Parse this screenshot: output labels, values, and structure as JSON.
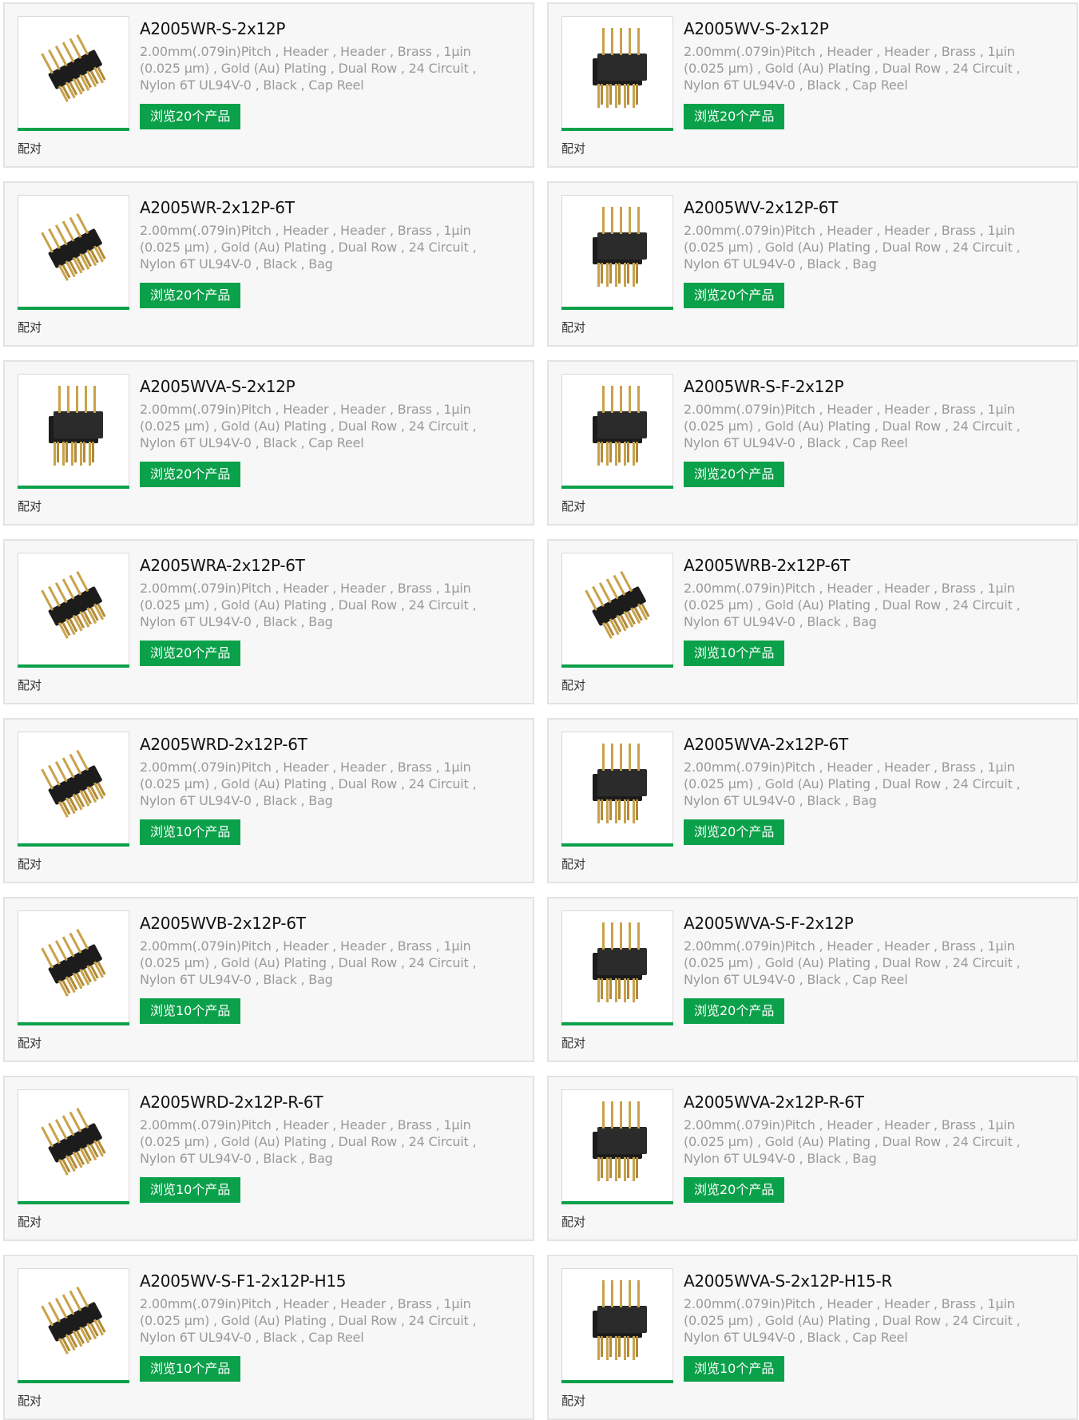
{
  "products": [
    {
      "name": "A2005WR-S-2x12P",
      "desc": "2.00mm(.079in)Pitch , Header , Header , Brass , 1µin (0.025 µm) , Gold (Au) Plating , Dual Row , 24 Circuit , Nylon 6T UL94V-0 , Black , Cap Reel",
      "browse": "浏览20个产品",
      "pair": "配对",
      "image": "right-angle-header-icon"
    },
    {
      "name": "A2005WV-S-2x12P",
      "desc": "2.00mm(.079in)Pitch , Header , Header , Brass , 1µin (0.025 µm) , Gold (Au) Plating , Dual Row , 24 Circuit , Nylon 6T UL94V-0 , Black , Cap Reel",
      "browse": "浏览20个产品",
      "pair": "配对",
      "image": "vertical-header-icon"
    },
    {
      "name": "A2005WR-2x12P-6T",
      "desc": "2.00mm(.079in)Pitch , Header , Header , Brass , 1µin (0.025 µm) , Gold (Au) Plating , Dual Row , 24 Circuit , Nylon 6T UL94V-0 , Black , Bag",
      "browse": "浏览20个产品",
      "pair": "配对",
      "image": "right-angle-header-icon"
    },
    {
      "name": "A2005WV-2x12P-6T",
      "desc": "2.00mm(.079in)Pitch , Header , Header , Brass , 1µin (0.025 µm) , Gold (Au) Plating , Dual Row , 24 Circuit , Nylon 6T UL94V-0 , Black , Bag",
      "browse": "浏览20个产品",
      "pair": "配对",
      "image": "vertical-header-icon"
    },
    {
      "name": "A2005WVA-S-2x12P",
      "desc": "2.00mm(.079in)Pitch , Header , Header , Brass , 1µin (0.025 µm) , Gold (Au) Plating , Dual Row , 24 Circuit , Nylon 6T UL94V-0 , Black , Cap Reel",
      "browse": "浏览20个产品",
      "pair": "配对",
      "image": "vertical-header-icon"
    },
    {
      "name": "A2005WR-S-F-2x12P",
      "desc": "2.00mm(.079in)Pitch , Header , Header , Brass , 1µin (0.025 µm) , Gold (Au) Plating , Dual Row , 24 Circuit , Nylon 6T UL94V-0 , Black , Cap Reel",
      "browse": "浏览20个产品",
      "pair": "配对",
      "image": "vertical-header-icon"
    },
    {
      "name": "A2005WRA-2x12P-6T",
      "desc": "2.00mm(.079in)Pitch , Header , Header , Brass , 1µin (0.025 µm) , Gold (Au) Plating , Dual Row , 24 Circuit , Nylon 6T UL94V-0 , Black , Bag",
      "browse": "浏览20个产品",
      "pair": "配对",
      "image": "right-angle-header-icon"
    },
    {
      "name": "A2005WRB-2x12P-6T",
      "desc": "2.00mm(.079in)Pitch , Header , Header , Brass , 1µin (0.025 µm) , Gold (Au) Plating , Dual Row , 24 Circuit , Nylon 6T UL94V-0 , Black , Bag",
      "browse": "浏览10个产品",
      "pair": "配对",
      "image": "right-angle-header-icon"
    },
    {
      "name": "A2005WRD-2x12P-6T",
      "desc": "2.00mm(.079in)Pitch , Header , Header , Brass , 1µin (0.025 µm) , Gold (Au) Plating , Dual Row , 24 Circuit , Nylon 6T UL94V-0 , Black , Bag",
      "browse": "浏览10个产品",
      "pair": "配对",
      "image": "right-angle-header-icon"
    },
    {
      "name": "A2005WVA-2x12P-6T",
      "desc": "2.00mm(.079in)Pitch , Header , Header , Brass , 1µin (0.025 µm) , Gold (Au) Plating , Dual Row , 24 Circuit , Nylon 6T UL94V-0 , Black , Bag",
      "browse": "浏览20个产品",
      "pair": "配对",
      "image": "vertical-header-icon"
    },
    {
      "name": "A2005WVB-2x12P-6T",
      "desc": "2.00mm(.079in)Pitch , Header , Header , Brass , 1µin (0.025 µm) , Gold (Au) Plating , Dual Row , 24 Circuit , Nylon 6T UL94V-0 , Black , Bag",
      "browse": "浏览10个产品",
      "pair": "配对",
      "image": "right-angle-header-icon"
    },
    {
      "name": "A2005WVA-S-F-2x12P",
      "desc": "2.00mm(.079in)Pitch , Header , Header , Brass , 1µin (0.025 µm) , Gold (Au) Plating , Dual Row , 24 Circuit , Nylon 6T UL94V-0 , Black , Cap Reel",
      "browse": "浏览20个产品",
      "pair": "配对",
      "image": "vertical-header-icon"
    },
    {
      "name": "A2005WRD-2x12P-R-6T",
      "desc": "2.00mm(.079in)Pitch , Header , Header , Brass , 1µin (0.025 µm) , Gold (Au) Plating , Dual Row , 24 Circuit , Nylon 6T UL94V-0 , Black , Bag",
      "browse": "浏览10个产品",
      "pair": "配对",
      "image": "right-angle-header-icon"
    },
    {
      "name": "A2005WVA-2x12P-R-6T",
      "desc": "2.00mm(.079in)Pitch , Header , Header , Brass , 1µin (0.025 µm) , Gold (Au) Plating , Dual Row , 24 Circuit , Nylon 6T UL94V-0 , Black , Bag",
      "browse": "浏览20个产品",
      "pair": "配对",
      "image": "vertical-header-icon"
    },
    {
      "name": "A2005WV-S-F1-2x12P-H15",
      "desc": "2.00mm(.079in)Pitch , Header , Header , Brass , 1µin (0.025 µm) , Gold (Au) Plating , Dual Row , 24 Circuit , Nylon 6T UL94V-0 , Black , Cap Reel",
      "browse": "浏览10个产品",
      "pair": "配对",
      "image": "right-angle-header-icon"
    },
    {
      "name": "A2005WVA-S-2x12P-H15-R",
      "desc": "2.00mm(.079in)Pitch , Header , Header , Brass , 1µin (0.025 µm) , Gold (Au) Plating , Dual Row , 24 Circuit , Nylon 6T UL94V-0 , Black , Cap Reel",
      "browse": "浏览10个产品",
      "pair": "配对",
      "image": "vertical-header-icon"
    }
  ],
  "colors": {
    "accent": "#0ba14a",
    "card_bg": "#f7f7f7",
    "border": "#e3e3e3",
    "title": "#111111",
    "desc": "#9a9a9a",
    "pin": "#c9a24a",
    "body": "#1c1c1c"
  }
}
